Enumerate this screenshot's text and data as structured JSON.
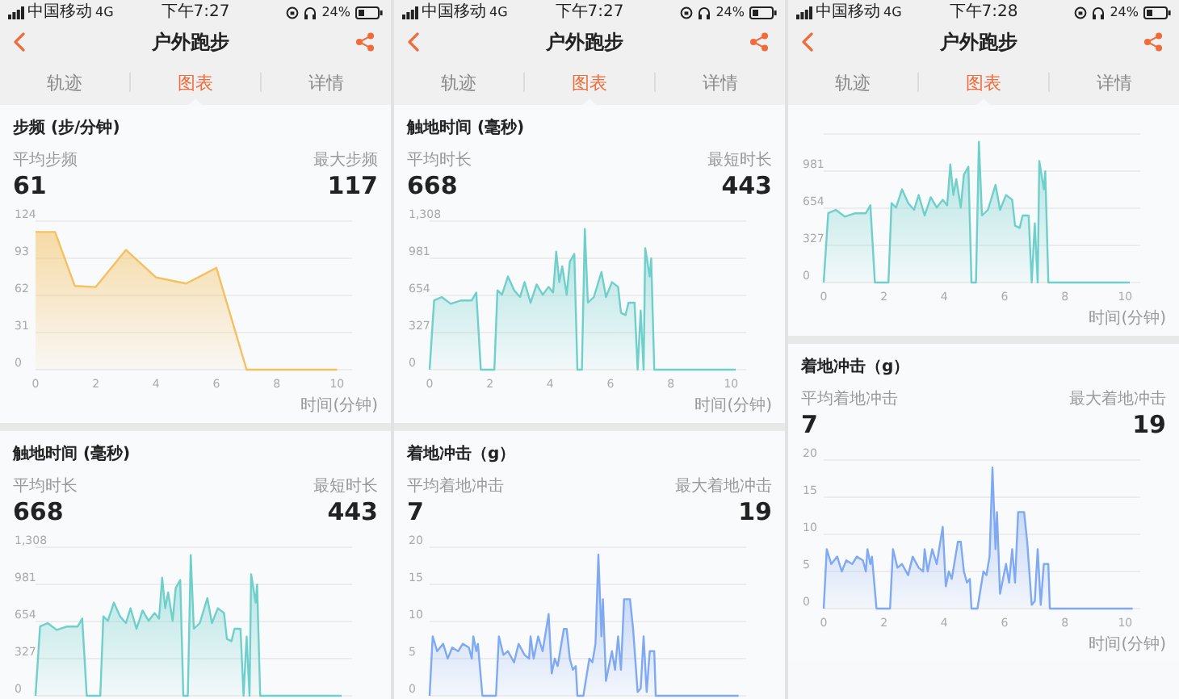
{
  "screens": [
    {
      "status_bar": {
        "carrier": "中国移动",
        "network": "4G",
        "time": "下午7:27",
        "battery": "24%"
      },
      "nav": {
        "title": "户外跑步"
      },
      "tabs": [
        {
          "label": "轨迹",
          "selected": false
        },
        {
          "label": "图表",
          "selected": true
        },
        {
          "label": "详情",
          "selected": false
        }
      ],
      "cards": [
        {
          "title": "步频 (步/分钟)",
          "stats": [
            {
              "label": "平均步频",
              "value": "61"
            },
            {
              "label": "最大步频",
              "value": "117"
            }
          ],
          "chart_data": {
            "type": "area",
            "xlabel": "时间(分钟)",
            "x": [
              0,
              0.65,
              1.3,
              2,
              3,
              4,
              5,
              6,
              7,
              8,
              9,
              10
            ],
            "grid": true,
            "series": [
              {
                "color": "#f3c15f",
                "values": [
                  115,
                  115,
                  70,
                  69,
                  100,
                  77,
                  72,
                  85,
                  0,
                  0,
                  0,
                  0
                ]
              }
            ],
            "xlim": [
              0,
              10.5
            ],
            "ylim": [
              0,
              124
            ],
            "xticks": [
              0,
              2,
              4,
              6,
              8,
              10
            ],
            "yticks": [
              0,
              31,
              62,
              93,
              124
            ]
          }
        },
        {
          "title": "触地时间 (毫秒)",
          "stats": [
            {
              "label": "平均时长",
              "value": "668"
            },
            {
              "label": "最短时长",
              "value": "443"
            }
          ],
          "chart_data": {
            "type": "area",
            "x": [
              0,
              0.15,
              0.4,
              0.7,
              1.05,
              1.4,
              1.55,
              1.7,
              2.15,
              2.25,
              2.4,
              2.6,
              2.8,
              3,
              3.15,
              3.35,
              3.55,
              3.75,
              3.95,
              4.1,
              4.2,
              4.3,
              4.4,
              4.55,
              4.65,
              4.8,
              4.9,
              5.05,
              5.15,
              5.25,
              5.45,
              5.7,
              5.85,
              6.05,
              6.25,
              6.35,
              6.5,
              6.6,
              6.8,
              6.9,
              7,
              7.1,
              7.15,
              7.3,
              7.35,
              7.45,
              10.15
            ],
            "grid": true,
            "series": [
              {
                "color": "#6fcfca",
                "values": [
                  0,
                  610,
                  640,
                  580,
                  610,
                  610,
                  680,
                  0,
                  0,
                  700,
                  660,
                  820,
                  700,
                  640,
                  770,
                  590,
                  750,
                  660,
                  730,
                  680,
                  1040,
                  770,
                  910,
                  660,
                  950,
                  1020,
                  0,
                  0,
                  1240,
                  590,
                  640,
                  860,
                  640,
                  770,
                  730,
                  500,
                  480,
                  590,
                  590,
                  0,
                  520,
                  0,
                  1070,
                  820,
                  980,
                  0,
                  0
                ]
              }
            ],
            "xlim": [
              0,
              10.5
            ],
            "ylim": [
              0,
              1308
            ],
            "yticks": [
              0,
              327,
              654,
              981,
              {
                "value": 1308,
                "label": "1,308"
              }
            ]
          }
        }
      ]
    },
    {
      "status_bar": {
        "carrier": "中国移动",
        "network": "4G",
        "time": "下午7:27",
        "battery": "24%"
      },
      "nav": {
        "title": "户外跑步"
      },
      "tabs": [
        {
          "label": "轨迹",
          "selected": false
        },
        {
          "label": "图表",
          "selected": true
        },
        {
          "label": "详情",
          "selected": false
        }
      ],
      "cards": [
        {
          "title": "触地时间 (毫秒)",
          "stats": [
            {
              "label": "平均时长",
              "value": "668"
            },
            {
              "label": "最短时长",
              "value": "443"
            }
          ],
          "chart_data": {
            "type": "area",
            "xlabel": "时间(分钟)",
            "x": [
              0,
              0.15,
              0.4,
              0.7,
              1.05,
              1.4,
              1.55,
              1.7,
              2.15,
              2.25,
              2.4,
              2.6,
              2.8,
              3,
              3.15,
              3.35,
              3.55,
              3.75,
              3.95,
              4.1,
              4.2,
              4.3,
              4.4,
              4.55,
              4.65,
              4.8,
              4.9,
              5.05,
              5.15,
              5.25,
              5.45,
              5.7,
              5.85,
              6.05,
              6.25,
              6.35,
              6.5,
              6.6,
              6.8,
              6.9,
              7,
              7.1,
              7.15,
              7.3,
              7.35,
              7.45,
              10.15
            ],
            "grid": true,
            "series": [
              {
                "color": "#6fcfca",
                "values": [
                  0,
                  610,
                  640,
                  580,
                  610,
                  610,
                  680,
                  0,
                  0,
                  700,
                  660,
                  820,
                  700,
                  640,
                  770,
                  590,
                  750,
                  660,
                  730,
                  680,
                  1040,
                  770,
                  910,
                  660,
                  950,
                  1020,
                  0,
                  0,
                  1240,
                  590,
                  640,
                  860,
                  640,
                  770,
                  730,
                  500,
                  480,
                  590,
                  590,
                  0,
                  520,
                  0,
                  1070,
                  820,
                  980,
                  0,
                  0
                ]
              }
            ],
            "xlim": [
              0,
              10.5
            ],
            "ylim": [
              0,
              1308
            ],
            "xticks": [
              0,
              2,
              4,
              6,
              8,
              10
            ],
            "yticks": [
              0,
              327,
              654,
              981,
              {
                "value": 1308,
                "label": "1,308"
              }
            ]
          }
        },
        {
          "title": "着地冲击（g）",
          "stats": [
            {
              "label": "平均着地冲击",
              "value": "7"
            },
            {
              "label": "最大着地冲击",
              "value": "19"
            }
          ],
          "chart_data": {
            "type": "area",
            "x": [
              0,
              0.1,
              0.25,
              0.45,
              0.6,
              0.75,
              0.95,
              1.1,
              1.3,
              1.4,
              1.45,
              1.55,
              1.6,
              1.75,
              2.2,
              2.3,
              2.45,
              2.6,
              2.8,
              2.95,
              3.15,
              3.3,
              3.35,
              3.45,
              3.6,
              3.75,
              3.95,
              4.05,
              4.15,
              4.25,
              4.45,
              4.55,
              4.65,
              4.75,
              4.85,
              4.9,
              5.1,
              5.3,
              5.4,
              5.5,
              5.6,
              5.7,
              5.75,
              5.85,
              6.05,
              6.15,
              6.25,
              6.35,
              6.45,
              6.65,
              6.75,
              6.9,
              7,
              7.1,
              7.2,
              7.3,
              7.45,
              7.5,
              10.25
            ],
            "grid": true,
            "series": [
              {
                "color": "#7fa9f2",
                "values": [
                  0,
                  8,
                  6,
                  7,
                  5,
                  6.5,
                  6,
                  7,
                  6.5,
                  5,
                  8,
                  6,
                  7,
                  0,
                  0,
                  8,
                  5.5,
                  6,
                  4.5,
                  7,
                  5.5,
                  5,
                  8,
                  5,
                  8,
                  6,
                  11,
                  3,
                  5,
                  4,
                  9,
                  9,
                  5,
                  3.5,
                  4,
                  0,
                  0,
                  5,
                  4.5,
                  7,
                  19,
                  8,
                  13,
                  2,
                  6,
                  3.5,
                  8,
                  3.5,
                  13,
                  13,
                  9,
                  0.5,
                  1,
                  8,
                  0.5,
                  6,
                  6,
                  0,
                  0
                ]
              }
            ],
            "xlim": [
              0,
              10.5
            ],
            "ylim": [
              0,
              20
            ],
            "yticks": [
              0,
              5,
              10,
              15,
              20
            ]
          }
        }
      ]
    },
    {
      "status_bar": {
        "carrier": "中国移动",
        "network": "4G",
        "time": "下午7:28",
        "battery": "24%"
      },
      "nav": {
        "title": "户外跑步"
      },
      "tabs": [
        {
          "label": "轨迹",
          "selected": false
        },
        {
          "label": "图表",
          "selected": true
        },
        {
          "label": "详情",
          "selected": false
        }
      ],
      "cards": [
        {
          "chart_data": {
            "type": "area",
            "xlabel": "时间(分钟)",
            "x": [
              0,
              0.15,
              0.4,
              0.7,
              1.05,
              1.4,
              1.55,
              1.7,
              2.15,
              2.25,
              2.4,
              2.6,
              2.8,
              3,
              3.15,
              3.35,
              3.55,
              3.75,
              3.95,
              4.1,
              4.2,
              4.3,
              4.4,
              4.55,
              4.65,
              4.8,
              4.9,
              5.05,
              5.15,
              5.25,
              5.45,
              5.7,
              5.85,
              6.05,
              6.25,
              6.35,
              6.5,
              6.6,
              6.8,
              6.9,
              7,
              7.1,
              7.15,
              7.3,
              7.35,
              7.45,
              10.15
            ],
            "grid": true,
            "series": [
              {
                "color": "#6fcfca",
                "values": [
                  0,
                  610,
                  640,
                  580,
                  610,
                  610,
                  680,
                  0,
                  0,
                  700,
                  660,
                  820,
                  700,
                  640,
                  770,
                  590,
                  750,
                  660,
                  730,
                  680,
                  1040,
                  770,
                  910,
                  660,
                  950,
                  1020,
                  0,
                  0,
                  1240,
                  590,
                  640,
                  860,
                  640,
                  770,
                  730,
                  500,
                  480,
                  590,
                  590,
                  0,
                  520,
                  0,
                  1070,
                  820,
                  980,
                  0,
                  0
                ]
              }
            ],
            "xlim": [
              0,
              10.5
            ],
            "ylim": [
              0,
              1308
            ],
            "xticks": [
              0,
              2,
              4,
              6,
              8,
              10
            ],
            "yticks": [
              0,
              327,
              654,
              981
            ]
          }
        },
        {
          "title": "着地冲击（g）",
          "stats": [
            {
              "label": "平均着地冲击",
              "value": "7"
            },
            {
              "label": "最大着地冲击",
              "value": "19"
            }
          ],
          "chart_data": {
            "type": "area",
            "xlabel": "时间(分钟)",
            "x": [
              0,
              0.1,
              0.25,
              0.45,
              0.6,
              0.75,
              0.95,
              1.1,
              1.3,
              1.4,
              1.45,
              1.55,
              1.6,
              1.75,
              2.2,
              2.3,
              2.45,
              2.6,
              2.8,
              2.95,
              3.15,
              3.3,
              3.35,
              3.45,
              3.6,
              3.75,
              3.95,
              4.05,
              4.15,
              4.25,
              4.45,
              4.55,
              4.65,
              4.75,
              4.85,
              4.9,
              5.1,
              5.3,
              5.4,
              5.5,
              5.6,
              5.7,
              5.75,
              5.85,
              6.05,
              6.15,
              6.25,
              6.35,
              6.45,
              6.65,
              6.75,
              6.9,
              7,
              7.1,
              7.2,
              7.3,
              7.45,
              7.5,
              10.25
            ],
            "grid": true,
            "series": [
              {
                "color": "#7fa9f2",
                "values": [
                  0,
                  8,
                  6,
                  7,
                  5,
                  6.5,
                  6,
                  7,
                  6.5,
                  5,
                  8,
                  6,
                  7,
                  0,
                  0,
                  8,
                  5.5,
                  6,
                  4.5,
                  7,
                  5.5,
                  5,
                  8,
                  5,
                  8,
                  6,
                  11,
                  3,
                  5,
                  4,
                  9,
                  9,
                  5,
                  3.5,
                  4,
                  0,
                  0,
                  5,
                  4.5,
                  7,
                  19,
                  8,
                  13,
                  2,
                  6,
                  3.5,
                  8,
                  3.5,
                  13,
                  13,
                  9,
                  0.5,
                  1,
                  8,
                  0.5,
                  6,
                  6,
                  0,
                  0
                ]
              }
            ],
            "xlim": [
              0,
              10.5
            ],
            "ylim": [
              0,
              20
            ],
            "xticks": [
              0,
              2,
              4,
              6,
              8,
              10
            ],
            "yticks": [
              0,
              5,
              10,
              15,
              20
            ]
          }
        }
      ]
    }
  ]
}
